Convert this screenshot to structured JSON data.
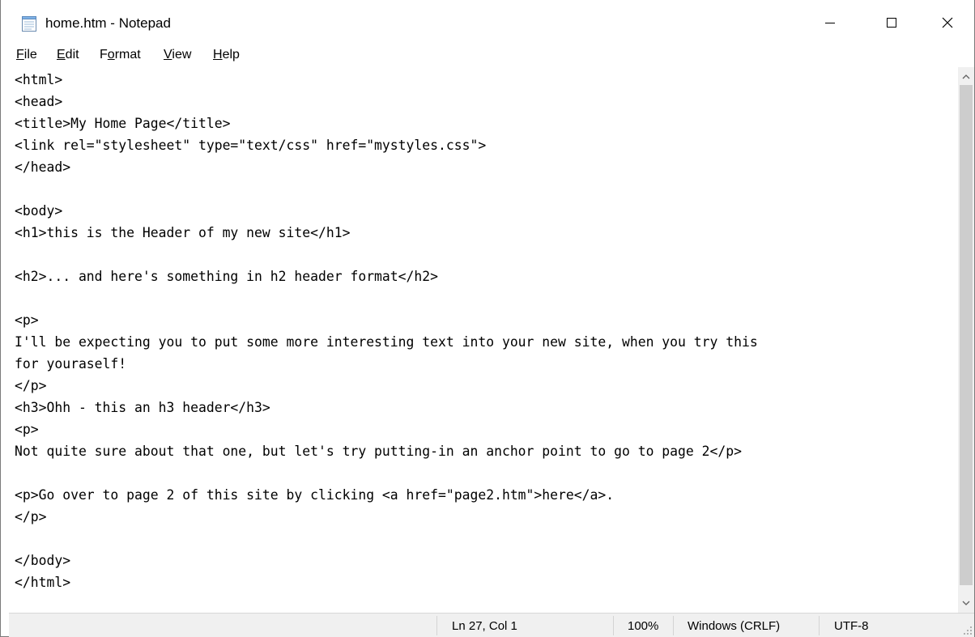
{
  "window": {
    "title": "home.htm - Notepad",
    "minimize_icon": "minimize-icon",
    "maximize_icon": "maximize-icon",
    "close_icon": "close-icon"
  },
  "menu": {
    "items": [
      {
        "accel": "F",
        "rest": "ile"
      },
      {
        "accel": "E",
        "rest": "dit"
      },
      {
        "pre": "F",
        "accel": "o",
        "rest": "rmat"
      },
      {
        "accel": "V",
        "rest": "iew"
      },
      {
        "accel": "H",
        "rest": "elp"
      }
    ]
  },
  "editor": {
    "lines": [
      "<html>",
      "<head>",
      "<title>My Home Page</title>",
      "<link rel=\"stylesheet\" type=\"text/css\" href=\"mystyles.css\">",
      "</head>",
      "",
      "<body>",
      "<h1>this is the Header of my new site</h1>",
      "",
      "<h2>... and here's something in h2 header format</h2>",
      "",
      "<p>",
      "I'll be expecting you to put some more interesting text into your new site, when you try this",
      "for youraself!",
      "</p>",
      "<h3>Ohh - this an h3 header</h3>",
      "<p>",
      "Not quite sure about that one, but let's try putting-in an anchor point to go to page 2</p>",
      "",
      "<p>Go over to page 2 of this site by clicking <a href=\"page2.htm\">here</a>.",
      "</p>",
      "",
      "</body>",
      "</html>"
    ]
  },
  "status": {
    "position": "Ln 27, Col 1",
    "zoom": "100%",
    "line_ending": "Windows (CRLF)",
    "encoding": "UTF-8"
  }
}
